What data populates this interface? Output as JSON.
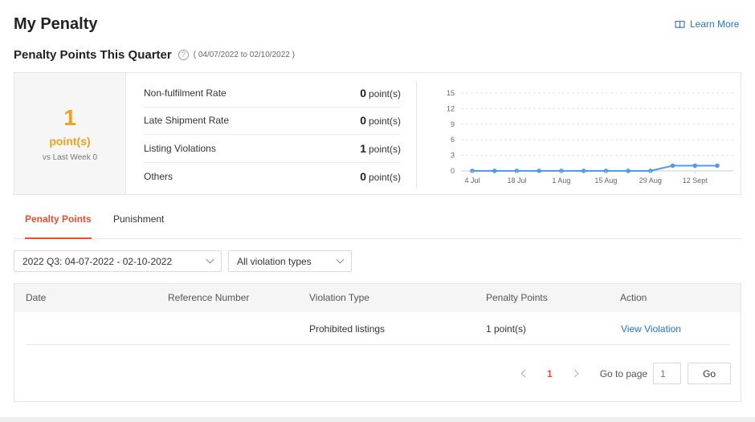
{
  "page": {
    "title": "My Penalty",
    "learn_more": "Learn More"
  },
  "quarter": {
    "title": "Penalty Points This Quarter",
    "help_icon": "?",
    "date_range": "( 04/07/2022 to 02/10/2022 )"
  },
  "summary": {
    "total": "1",
    "unit": "point(s)",
    "comparison": "vs Last Week 0"
  },
  "metrics": [
    {
      "label": "Non-fulfilment Rate",
      "value": "0",
      "unit": "point(s)"
    },
    {
      "label": "Late Shipment Rate",
      "value": "0",
      "unit": "point(s)"
    },
    {
      "label": "Listing Violations",
      "value": "1",
      "unit": "point(s)"
    },
    {
      "label": "Others",
      "value": "0",
      "unit": "point(s)"
    }
  ],
  "chart_data": {
    "type": "line",
    "ylim": [
      0,
      15
    ],
    "yticks": [
      "15",
      "12",
      "9",
      "6",
      "3",
      "0"
    ],
    "xtick_labels": [
      "4 Jul",
      "18 Jul",
      "1 Aug",
      "15 Aug",
      "29 Aug",
      "12 Sept"
    ],
    "points": [
      0,
      0,
      0,
      0,
      0,
      0,
      0,
      0,
      0,
      1,
      1,
      1
    ],
    "color": "#4e9de6",
    "grid": true
  },
  "tabs": [
    {
      "label": "Penalty Points",
      "active": true
    },
    {
      "label": "Punishment",
      "active": false
    }
  ],
  "filters": {
    "period": "2022 Q3: 04-07-2022 - 02-10-2022",
    "violation_type": "All violation types"
  },
  "table": {
    "headers": [
      "Date",
      "Reference Number",
      "Violation Type",
      "Penalty Points",
      "Action"
    ],
    "rows": [
      {
        "date": "",
        "reference": "",
        "violation_type": "Prohibited listings",
        "points": "1 point(s)",
        "action": "View Violation"
      }
    ]
  },
  "pagination": {
    "current_page": "1",
    "goto_label": "Go to page",
    "goto_placeholder": "1",
    "go_button": "Go"
  },
  "colors": {
    "accent": "#ee4d2d",
    "score": "#f0a21d",
    "link": "#2673dd"
  }
}
